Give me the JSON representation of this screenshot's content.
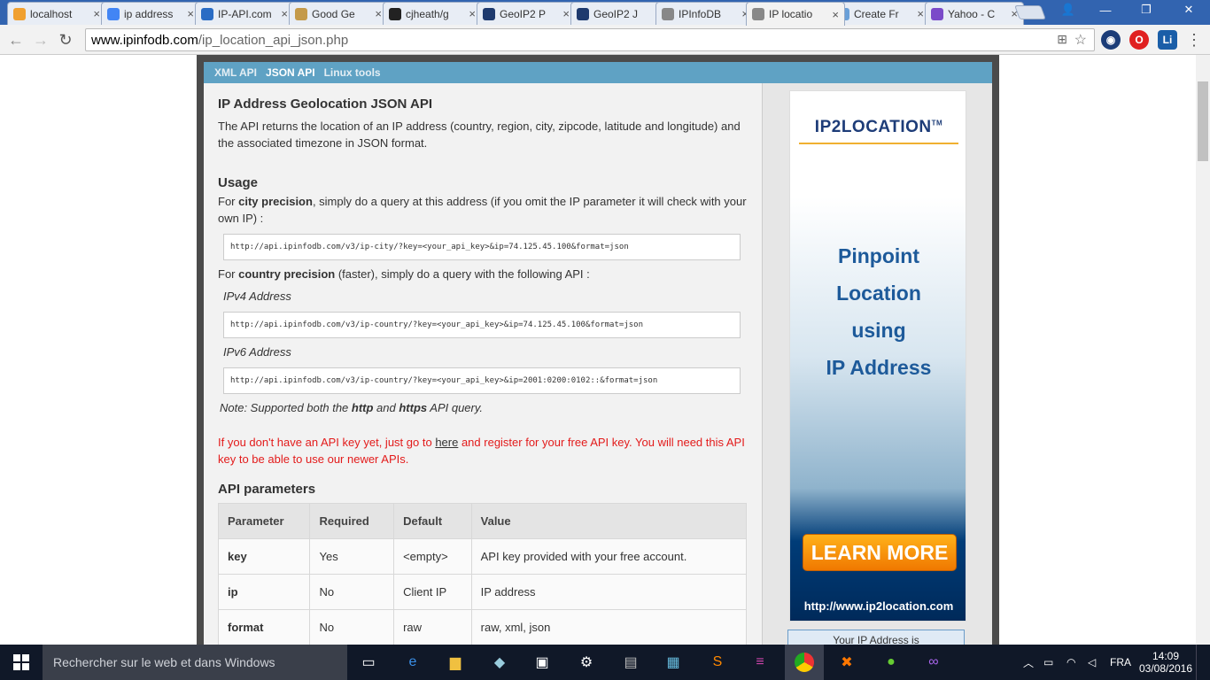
{
  "tabs": [
    {
      "label": "localhost",
      "color": "#f0a030"
    },
    {
      "label": "ip address",
      "color": "#4285f4"
    },
    {
      "label": "IP-API.com",
      "color": "#2a6cc4"
    },
    {
      "label": "Good Ge",
      "color": "#c49a4a"
    },
    {
      "label": "cjheath/g",
      "color": "#222222"
    },
    {
      "label": "GeoIP2 P",
      "color": "#1e3a6e"
    },
    {
      "label": "GeoIP2 J",
      "color": "#1e3a6e"
    },
    {
      "label": "IPInfoDB",
      "color": "#888888"
    },
    {
      "label": "IP locatio",
      "color": "#888888"
    },
    {
      "label": "Create Fr",
      "color": "#6aa0d8"
    },
    {
      "label": "Yahoo - C",
      "color": "#7b4bc9"
    }
  ],
  "window": {
    "min": "—",
    "restore": "❐",
    "close": "✕",
    "user": "👤"
  },
  "address": {
    "domain": "www.ipinfodb.com",
    "path": "/ip_location_api_json.php"
  },
  "subnav": {
    "xml": "XML API",
    "json": "JSON API",
    "linux": "Linux tools"
  },
  "page": {
    "title": "IP Address Geolocation JSON API",
    "intro": "The API returns the location of an IP address (country, region, city, zipcode, latitude and longitude) and the associated timezone in JSON format.",
    "usage_heading": "Usage",
    "city_pre": "For ",
    "city_bold": "city precision",
    "city_post": ", simply do a query at this address (if you omit the IP parameter it will check with your own IP) :",
    "city_url": "http://api.ipinfodb.com/v3/ip-city/?key=<your_api_key>&ip=74.125.45.100&format=json",
    "country_pre": "For ",
    "country_bold": "country precision",
    "country_post": " (faster), simply do a query with the following API :",
    "ipv4_label": "IPv4 Address",
    "ipv4_url": "http://api.ipinfodb.com/v3/ip-country/?key=<your_api_key>&ip=74.125.45.100&format=json",
    "ipv6_label": "IPv6 Address",
    "ipv6_url": "http://api.ipinfodb.com/v3/ip-country/?key=<your_api_key>&ip=2001:0200:0102::&format=json",
    "note_pre": "Note: Supported both the ",
    "note_http": "http",
    "note_mid": " and ",
    "note_https": "https",
    "note_post": " API query.",
    "warn_pre": "If you don't have an API key yet, just go to ",
    "warn_link": "here",
    "warn_post": " and register for your free API key. You will need this API key to be able to use our newer APIs.",
    "params_heading": "API parameters",
    "table_headers": [
      "Parameter",
      "Required",
      "Default",
      "Value"
    ],
    "table_rows": [
      [
        "key",
        "Yes",
        "<empty>",
        "API key provided with your free account."
      ],
      [
        "ip",
        "No",
        "Client IP",
        "IP address"
      ],
      [
        "format",
        "No",
        "raw",
        "raw, xml, json"
      ]
    ]
  },
  "ad": {
    "logo": "IP2LOCATION",
    "tm": "TM",
    "line1": "Pinpoint",
    "line2": "Location",
    "line3": "using",
    "line4": "IP Address",
    "button": "LEARN MORE",
    "url": "http://www.ip2location.com",
    "yourip": "Your IP Address is"
  },
  "taskbar": {
    "search": "Rechercher sur le web et dans Windows",
    "lang": "FRA",
    "time": "14:09",
    "date": "03/08/2016"
  }
}
